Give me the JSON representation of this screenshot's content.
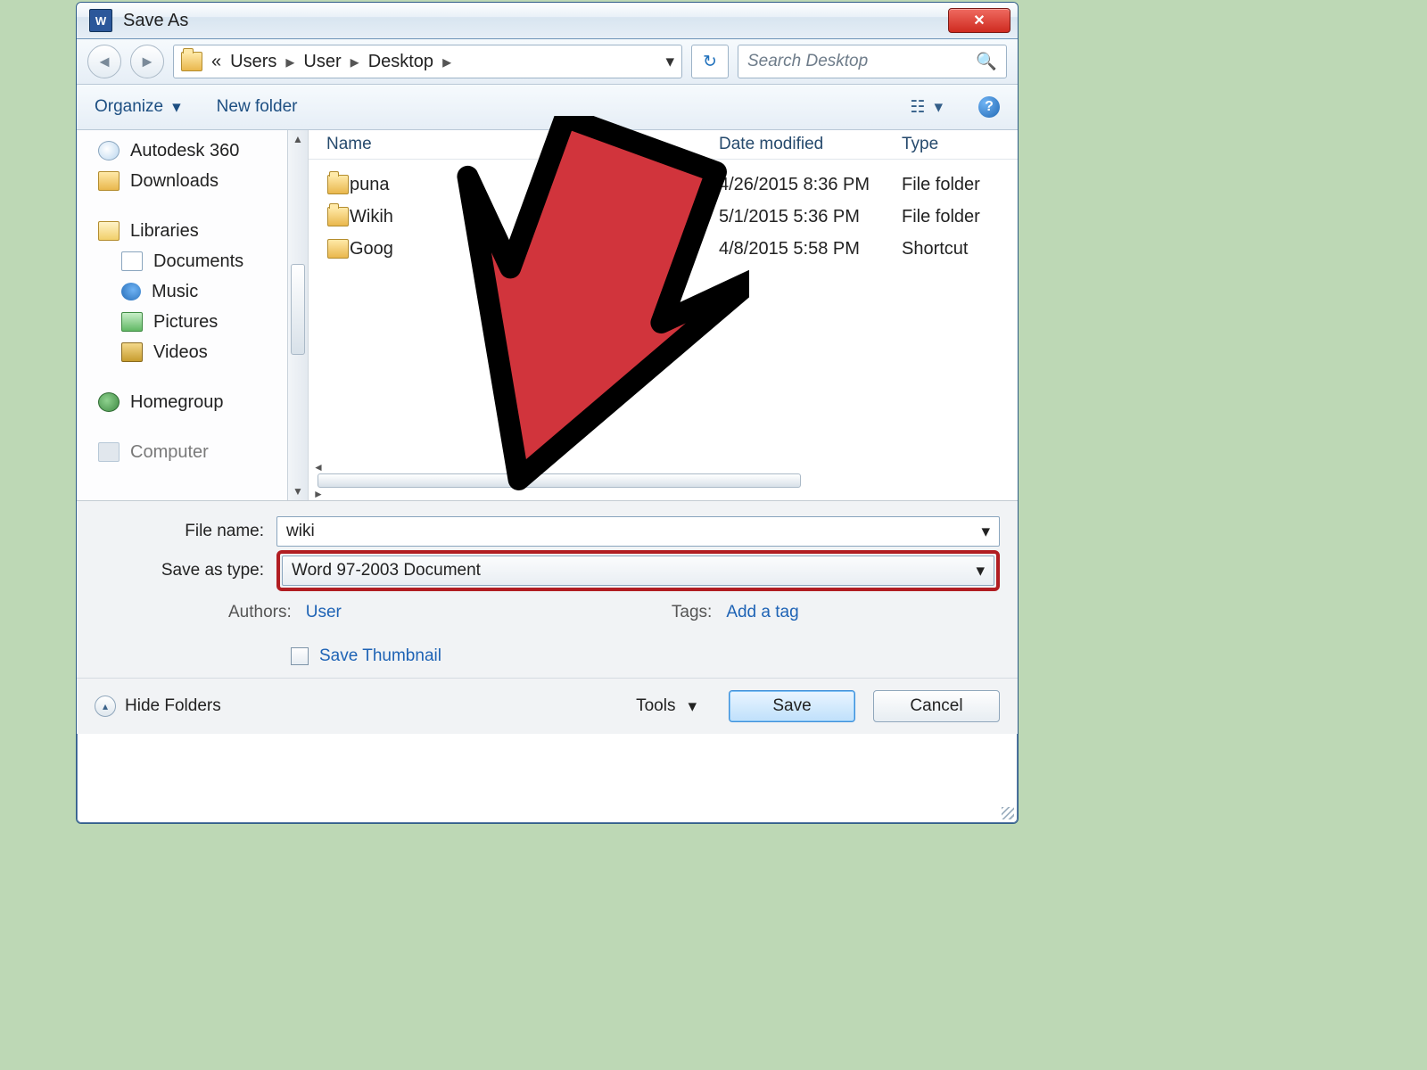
{
  "window": {
    "title": "Save As"
  },
  "nav": {
    "crumbs": [
      "Users",
      "User",
      "Desktop"
    ],
    "search_placeholder": "Search Desktop"
  },
  "toolbar": {
    "organize": "Organize",
    "new_folder": "New folder"
  },
  "sidebar": {
    "items": [
      {
        "label": "Autodesk 360",
        "icon": "cloud"
      },
      {
        "label": "Downloads",
        "icon": "dl"
      }
    ],
    "libraries_label": "Libraries",
    "libraries": [
      {
        "label": "Documents",
        "icon": "doc"
      },
      {
        "label": "Music",
        "icon": "mus"
      },
      {
        "label": "Pictures",
        "icon": "pic"
      },
      {
        "label": "Videos",
        "icon": "vid"
      }
    ],
    "homegroup_label": "Homegroup",
    "computer_label": "Computer"
  },
  "columns": {
    "name": "Name",
    "date": "Date modified",
    "type": "Type"
  },
  "files": [
    {
      "name": "puna",
      "date": "4/26/2015 8:36 PM",
      "type": "File folder",
      "icon": "folder"
    },
    {
      "name": "Wikih",
      "date": "5/1/2015 5:36 PM",
      "type": "File folder",
      "icon": "folder"
    },
    {
      "name": "Goog",
      "date": "4/8/2015 5:58 PM",
      "type": "Shortcut",
      "icon": "short"
    }
  ],
  "form": {
    "file_name_label": "File name:",
    "file_name_value": "wiki",
    "save_type_label": "Save as type:",
    "save_type_value": "Word 97-2003 Document",
    "authors_label": "Authors:",
    "authors_value": "User",
    "tags_label": "Tags:",
    "tags_value": "Add a tag",
    "thumbnail_label": "Save Thumbnail"
  },
  "footer": {
    "hide_folders": "Hide Folders",
    "tools": "Tools",
    "save": "Save",
    "cancel": "Cancel"
  }
}
